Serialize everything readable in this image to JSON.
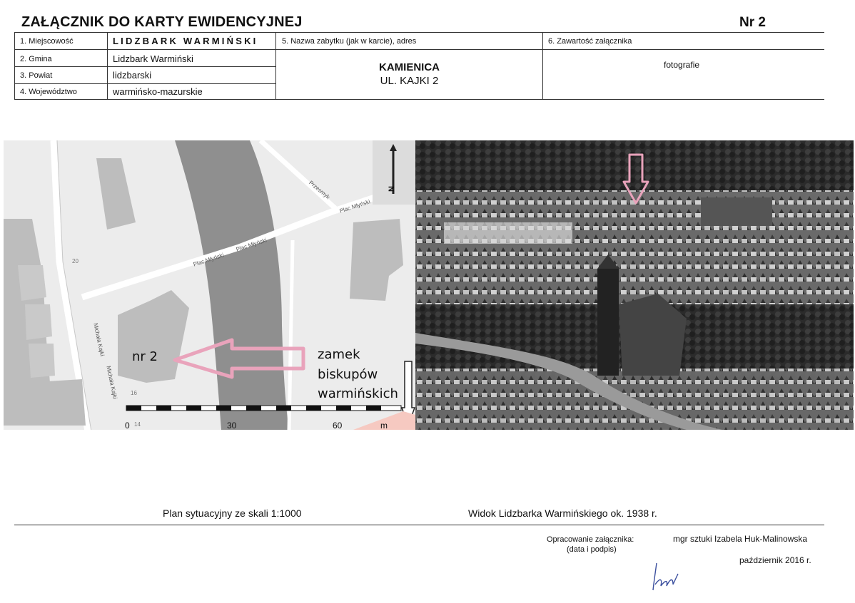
{
  "header": {
    "title": "ZAŁĄCZNIK DO KARTY EWIDENCYJNEJ",
    "nr": "Nr 2"
  },
  "form": {
    "miejscowosc_label": "1. Miejscowość",
    "miejscowosc_value": "LIDZBARK WARMIŃSKI",
    "gmina_label": "2. Gmina",
    "gmina_value": "Lidzbark Warmiński",
    "powiat_label": "3. Powiat",
    "powiat_value": "lidzbarski",
    "wojewodztwo_label": "4. Województwo",
    "wojewodztwo_value": "warmińsko-mazurskie",
    "zabytek_label": "5. Nazwa zabytku (jak w karcie), adres",
    "zabytek_name": "KAMIENICA",
    "zabytek_address": "UL. KAJKI 2",
    "zawartosc_label": "6. Zawartość załącznika",
    "zawartosc_value": "fotografie"
  },
  "map": {
    "building_label": "nr 2",
    "castle_label_1": "zamek",
    "castle_label_2": "biskupów",
    "castle_label_3": "warmińskich",
    "north_label": "N",
    "street_labels": [
      "Plac Młyński",
      "Plac Młyński",
      "Plac Młyński",
      "Przesmyk",
      "Michała Kajki",
      "Michała Kajki"
    ],
    "scale_ticks": [
      "0",
      "30",
      "60"
    ],
    "scale_unit": "m",
    "house_numbers": [
      "20",
      "16",
      "14"
    ]
  },
  "captions": {
    "plan": "Plan sytuacyjny ze skali 1:1000",
    "view": "Widok Lidzbarka Warmińskiego ok. 1938 r."
  },
  "footer": {
    "prepared_label_1": "Opracowanie załącznika:",
    "prepared_label_2": "(data i podpis)",
    "author": "mgr sztuki Izabela Huk-Malinowska",
    "date": "październik 2016 r."
  },
  "colors": {
    "arrow_pink": "#e9a3bb",
    "river_gray": "#8c8c8c",
    "map_bg": "#ececec",
    "building_gray": "#bdbdbd"
  }
}
